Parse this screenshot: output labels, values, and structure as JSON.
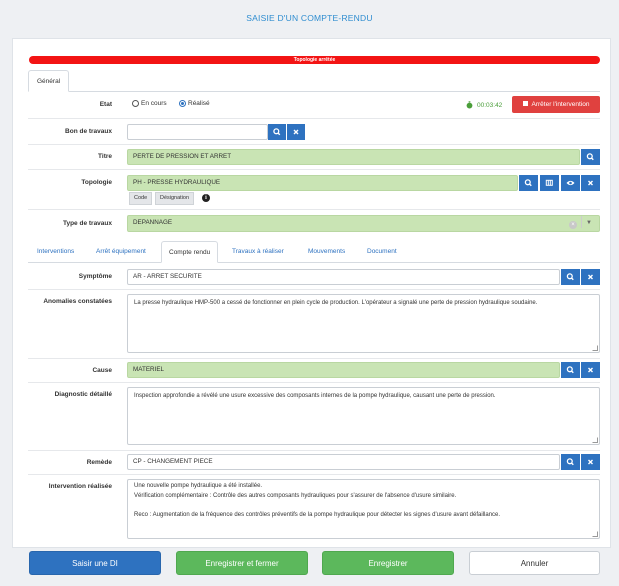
{
  "page_title": "SAISIE D'UN COMPTE-RENDU",
  "alert_bar": "Topologie arrêtée",
  "tabs": {
    "general": "Général"
  },
  "etat": {
    "label": "Etat",
    "option1": "En cours",
    "option2": "Réalisé",
    "selected": "Réalisé",
    "timer": "00:03:42",
    "stop_button": "Arrêter l'intervention"
  },
  "bon_travaux": {
    "label": "Bon de travaux",
    "value": ""
  },
  "titre": {
    "label": "Titre",
    "value": "PERTE DE PRESSION ET ARRET"
  },
  "topologie": {
    "label": "Topologie",
    "value": "PH - PRESSE HYDRAULIQUE",
    "chip_code": "Code",
    "chip_designation": "Désignation"
  },
  "type_travaux": {
    "label": "Type de travaux",
    "value": "DEPANNAGE"
  },
  "subtabs": [
    "Interventions",
    "Arrêt équipement",
    "Compte rendu",
    "Travaux à réaliser",
    "Mouvements",
    "Document"
  ],
  "active_subtab": "Compte rendu",
  "symptome": {
    "label": "Symptôme",
    "value": "AR - ARRET SECURITE"
  },
  "anomalies": {
    "label": "Anomalies constatées",
    "value": "La presse hydraulique HMP-500 a cessé de fonctionner en plein cycle de production. L'opérateur a signalé une perte de pression hydraulique soudaine."
  },
  "cause": {
    "label": "Cause",
    "value": "MATERIEL"
  },
  "diagnostic": {
    "label": "Diagnostic détaillé",
    "value": "Inspection approfondie a révélé une usure excessive des composants internes de la pompe hydraulique, causant une perte de pression."
  },
  "remede": {
    "label": "Remède",
    "value": "CP - CHANGEMENT PIECE"
  },
  "intervention": {
    "label": "Intervention réalisée",
    "value": "Une nouvelle pompe hydraulique a été installée.\nVérification complémentaire : Contrôle des autres composants hydrauliques pour s'assurer de l'absence d'usure similaire.\n\nReco : Augmentation de la fréquence des contrôles préventifs de la pompe hydraulique pour détecter les signes d'usure avant défaillance."
  },
  "footer": {
    "saisir_di": "Saisir une DI",
    "enregistrer_fermer": "Enregistrer et fermer",
    "enregistrer": "Enregistrer",
    "annuler": "Annuler"
  },
  "colors": {
    "primary": "#2e72c0",
    "success": "#5cb85c",
    "danger": "#e0413f",
    "alert": "#f31414",
    "field_green": "#c9e4b4"
  }
}
